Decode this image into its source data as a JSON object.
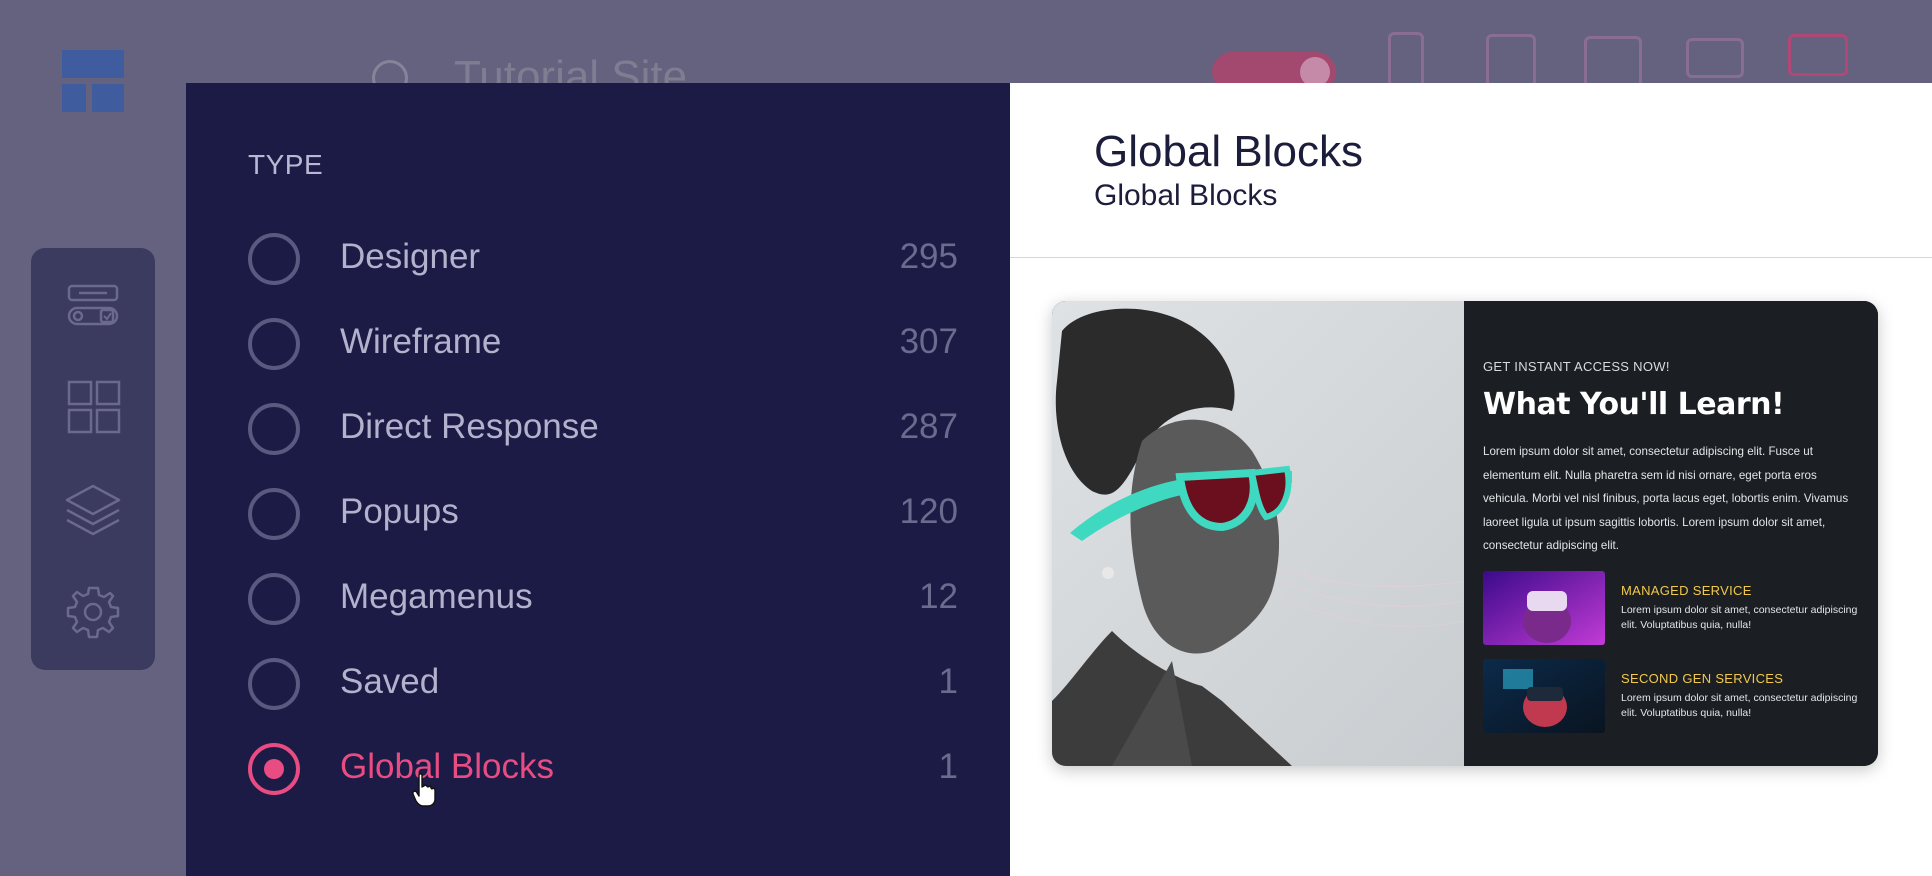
{
  "background_app": {
    "site_title": "Tutorial Site",
    "sidebar_icons": [
      "components-icon",
      "grid-icon",
      "layers-icon",
      "gear-icon"
    ],
    "device_icons": [
      "mobile-portrait-icon",
      "tablet-portrait-icon",
      "tablet-landscape-icon",
      "laptop-icon",
      "desktop-icon"
    ]
  },
  "filter_panel": {
    "heading": "TYPE",
    "items": [
      {
        "label": "Designer",
        "count": "295",
        "selected": false
      },
      {
        "label": "Wireframe",
        "count": "307",
        "selected": false
      },
      {
        "label": "Direct Response",
        "count": "287",
        "selected": false
      },
      {
        "label": "Popups",
        "count": "120",
        "selected": false
      },
      {
        "label": "Megamenus",
        "count": "12",
        "selected": false
      },
      {
        "label": "Saved",
        "count": "1",
        "selected": false
      },
      {
        "label": "Global Blocks",
        "count": "1",
        "selected": true
      }
    ]
  },
  "preview_panel": {
    "title": "Global Blocks",
    "subtitle": "Global Blocks",
    "card": {
      "eyebrow": "GET INSTANT ACCESS NOW!",
      "headline": "What You'll Learn!",
      "body": "Lorem ipsum dolor sit amet, consectetur adipiscing elit. Fusce ut elementum elit. Nulla pharetra sem id nisi ornare, eget porta eros vehicula. Morbi vel nisl finibus, porta lacus eget, lobortis enim. Vivamus laoreet ligula ut ipsum sagittis lobortis. Lorem ipsum dolor sit amet, consectetur adipiscing elit.",
      "services": [
        {
          "title": "MANAGED SERVICE",
          "text": "Lorem ipsum dolor sit amet, consectetur adipiscing elit. Voluptatibus quia, nulla!"
        },
        {
          "title": "SECOND GEN SERVICES",
          "text": "Lorem ipsum dolor sit amet, consectetur adipiscing elit. Voluptatibus quia, nulla!"
        }
      ]
    }
  },
  "colors": {
    "accent": "#e84c82",
    "panel_bg": "#1b1b46",
    "service_title": "#f2c94c"
  }
}
